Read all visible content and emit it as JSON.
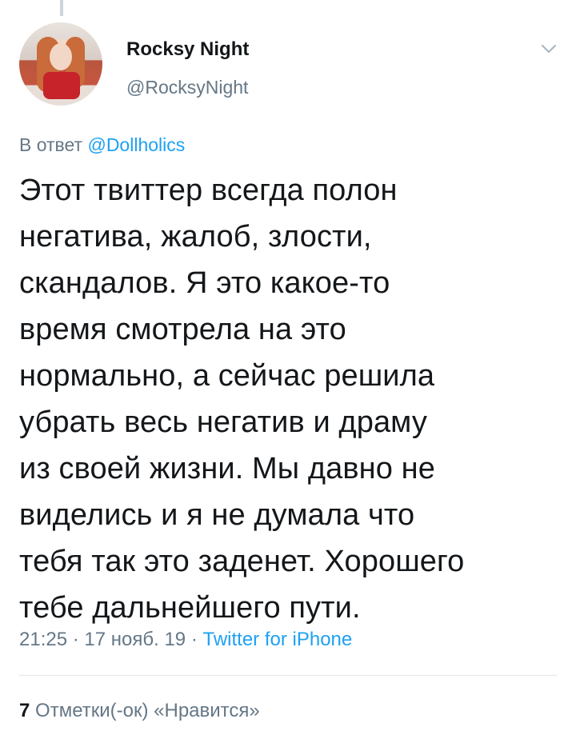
{
  "tweet": {
    "author_name": "Rocksy Night",
    "author_handle": "@RocksyNight",
    "reply_prefix": "В ответ",
    "reply_to": "@Dollholics",
    "text": "Этот твиттер всегда полон\nнегатива, жалоб, злости,\nскандалов. Я это какое-то\nвремя смотрела на это\nнормально, а сейчас решила\nубрать весь негатив и драму\nиз своей жизни. Мы давно не\nвиделись и я не думала что\nтебя так это заденет. Хорошего\nтебе дальнейшего пути.",
    "time": "21:25",
    "date": "17 нояб. 19",
    "separator": "·",
    "source": "Twitter for iPhone",
    "likes_count": "7",
    "likes_label": "Отметки(-ок) «Нравится»"
  },
  "icons": {
    "more": "chevron-down-icon",
    "avatar": "profile-photo"
  },
  "colors": {
    "link": "#1da1f2",
    "secondary_text": "#657786",
    "primary_text": "#14171a"
  }
}
